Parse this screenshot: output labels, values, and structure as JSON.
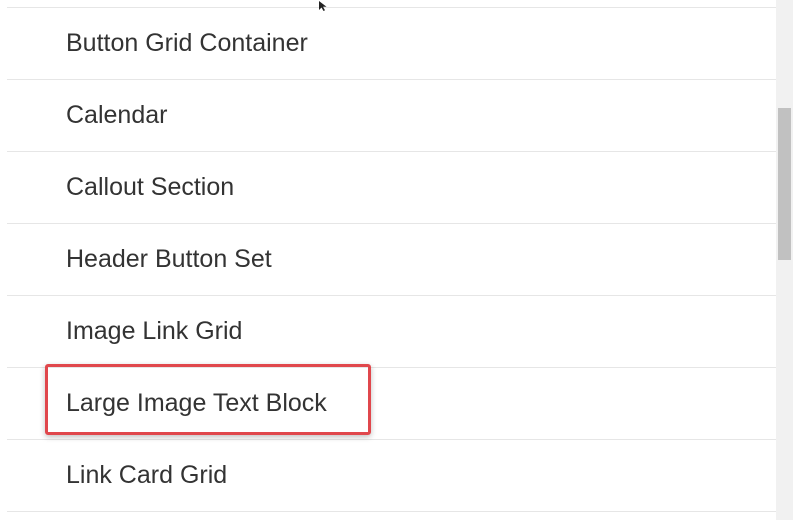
{
  "list": {
    "items": [
      {
        "label": "Button Grid Container"
      },
      {
        "label": "Calendar"
      },
      {
        "label": "Callout Section"
      },
      {
        "label": "Header Button Set"
      },
      {
        "label": "Image Link Grid"
      },
      {
        "label": "Large Image Text Block",
        "highlighted": true
      },
      {
        "label": "Link Card Grid"
      }
    ]
  },
  "colors": {
    "highlight_border": "#e0474c",
    "divider": "#e6e6e6",
    "text": "#333333",
    "scrollbar_track": "#f1f1f1",
    "scrollbar_thumb": "#c1c1c1"
  }
}
